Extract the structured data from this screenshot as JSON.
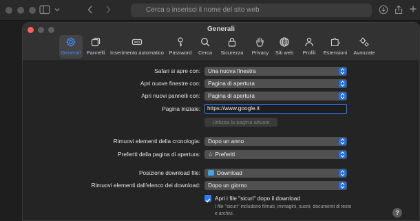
{
  "browser": {
    "address_placeholder": "Cerca o inserisci il nome del sito web"
  },
  "window": {
    "title": "Generali"
  },
  "tabs": [
    {
      "label": "Generali",
      "icon": "gear-icon",
      "active": true
    },
    {
      "label": "Pannelli",
      "icon": "tabs-icon"
    },
    {
      "label": "Inserimento automatico",
      "icon": "autofill-icon"
    },
    {
      "label": "Password",
      "icon": "key-icon"
    },
    {
      "label": "Cerca",
      "icon": "search-icon"
    },
    {
      "label": "Sicurezza",
      "icon": "lock-icon"
    },
    {
      "label": "Privacy",
      "icon": "hand-icon"
    },
    {
      "label": "Siti web",
      "icon": "globe-icon"
    },
    {
      "label": "Profili",
      "icon": "person-icon"
    },
    {
      "label": "Estensioni",
      "icon": "puzzle-icon"
    },
    {
      "label": "Avanzate",
      "icon": "gears-icon"
    }
  ],
  "form": {
    "open_with_label": "Safari si apre con:",
    "open_with_value": "Una nuova finestra",
    "new_windows_label": "Apri nuove finestre con:",
    "new_windows_value": "Pagina di apertura",
    "new_tabs_label": "Apri nuovi pannelli con:",
    "new_tabs_value": "Pagina di apertura",
    "homepage_label": "Pagina iniziale:",
    "homepage_value": "https://www.google.it",
    "use_current_label": "Utilizza la pagina attuale",
    "history_label": "Rimuovi elementi della cronologia:",
    "history_value": "Dopo un anno",
    "favorites_label": "Preferiti della pagina di apertura:",
    "favorites_value": "Preferiti",
    "download_location_label": "Posizione download file:",
    "download_location_value": "Download",
    "remove_downloads_label": "Rimuovi elementi dall'elenco dei download:",
    "remove_downloads_value": "Dopo un giorno",
    "open_safe_label": "Apri i file \"sicuri\" dopo il download",
    "open_safe_checked": true,
    "open_safe_note": "I file \"sicuri\" includono filmati, immagini, suoni, documenti di testo e archivi."
  },
  "help_label": "?",
  "colors": {
    "accent": "#2f7cf6",
    "close_button": "#ff5f57"
  }
}
